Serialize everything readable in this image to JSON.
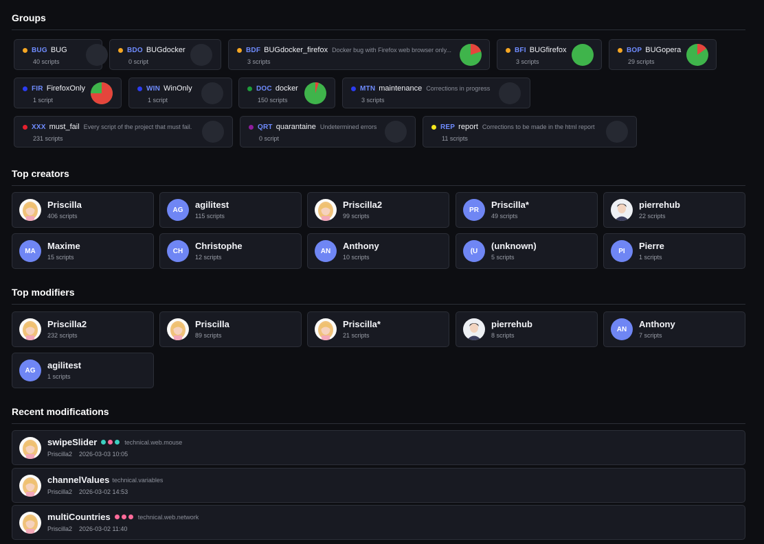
{
  "sections": {
    "groups": "Groups",
    "top_creators": "Top creators",
    "top_modifiers": "Top modifiers",
    "recent": "Recent modifications"
  },
  "colors": {
    "pass": "#3fb44b",
    "fail": "#e5453c",
    "empty": "#262932",
    "avatar_bg": "#6f86f4",
    "dot_teal": "#3ccfc0",
    "dot_pink": "#ff6b9a"
  },
  "groups": [
    {
      "code": "BUG",
      "name": "BUG",
      "desc": "",
      "count": "40 scripts",
      "dot": "#f5a623",
      "fail_ratio": null
    },
    {
      "code": "BDO",
      "name": "BUGdocker",
      "desc": "",
      "count": "0 script",
      "dot": "#f5a623",
      "fail_ratio": null
    },
    {
      "code": "BDF",
      "name": "BUGdocker_firefox",
      "desc": "Docker bug with Firefox web browser only...",
      "count": "3 scripts",
      "dot": "#f5a623",
      "fail_ratio": 0.2
    },
    {
      "code": "BFI",
      "name": "BUGfirefox",
      "desc": "",
      "count": "3 scripts",
      "dot": "#f5a623",
      "fail_ratio": 0
    },
    {
      "code": "BOP",
      "name": "BUGopera",
      "desc": "",
      "count": "29 scripts",
      "dot": "#f5a623",
      "fail_ratio": 0.15
    },
    {
      "code": "FIR",
      "name": "FirefoxOnly",
      "desc": "",
      "count": "1 script",
      "dot": "#2b3cf0",
      "fail_ratio": 0.75
    },
    {
      "code": "WIN",
      "name": "WinOnly",
      "desc": "",
      "count": "1 script",
      "dot": "#2b3cf0",
      "fail_ratio": null
    },
    {
      "code": "DOC",
      "name": "docker",
      "desc": "",
      "count": "150 scripts",
      "dot": "#1e9b3a",
      "fail_ratio": 0.05
    },
    {
      "code": "MTN",
      "name": "maintenance",
      "desc": "Corrections in progress",
      "count": "3 scripts",
      "dot": "#2b3cf0",
      "fail_ratio": null
    },
    {
      "code": "XXX",
      "name": "must_fail",
      "desc": "Every script of the project that must fail.",
      "count": "231 scripts",
      "dot": "#e5202e",
      "fail_ratio": null
    },
    {
      "code": "QRT",
      "name": "quarantaine",
      "desc": "Undetermined errors",
      "count": "0 script",
      "dot": "#8e1d9c",
      "fail_ratio": null
    },
    {
      "code": "REP",
      "name": "report",
      "desc": "Corrections to be made in the html report",
      "count": "11 scripts",
      "dot": "#f5e81d",
      "fail_ratio": null
    }
  ],
  "creators": [
    {
      "name": "Priscilla",
      "count": "406 scripts",
      "avatar": "photo-blonde",
      "initials": ""
    },
    {
      "name": "agilitest",
      "count": "115 scripts",
      "avatar": "initials",
      "initials": "AG"
    },
    {
      "name": "Priscilla2",
      "count": "99 scripts",
      "avatar": "photo-blonde",
      "initials": ""
    },
    {
      "name": "Priscilla*",
      "count": "49 scripts",
      "avatar": "initials",
      "initials": "PR"
    },
    {
      "name": "pierrehub",
      "count": "22 scripts",
      "avatar": "photo-man",
      "initials": ""
    },
    {
      "name": "Maxime",
      "count": "15 scripts",
      "avatar": "initials",
      "initials": "MA"
    },
    {
      "name": "Christophe",
      "count": "12 scripts",
      "avatar": "initials",
      "initials": "CH"
    },
    {
      "name": "Anthony",
      "count": "10 scripts",
      "avatar": "initials",
      "initials": "AN"
    },
    {
      "name": "(unknown)",
      "count": "5 scripts",
      "avatar": "initials",
      "initials": "(U"
    },
    {
      "name": "Pierre",
      "count": "1 scripts",
      "avatar": "initials",
      "initials": "PI"
    }
  ],
  "modifiers": [
    {
      "name": "Priscilla2",
      "count": "232 scripts",
      "avatar": "photo-blonde",
      "initials": ""
    },
    {
      "name": "Priscilla",
      "count": "89 scripts",
      "avatar": "photo-blonde",
      "initials": ""
    },
    {
      "name": "Priscilla*",
      "count": "21 scripts",
      "avatar": "photo-blonde",
      "initials": ""
    },
    {
      "name": "pierrehub",
      "count": "8 scripts",
      "avatar": "photo-man",
      "initials": ""
    },
    {
      "name": "Anthony",
      "count": "7 scripts",
      "avatar": "initials",
      "initials": "AN"
    },
    {
      "name": "agilitest",
      "count": "1 scripts",
      "avatar": "initials",
      "initials": "AG"
    }
  ],
  "recent": [
    {
      "name": "swipeSlider",
      "dots": [
        "teal",
        "pink",
        "teal"
      ],
      "path": "technical.web.mouse",
      "user": "Priscilla2",
      "date": "2026-03-03 10:05"
    },
    {
      "name": "channelValues",
      "dots": [],
      "path": "technical.variables",
      "user": "Priscilla2",
      "date": "2026-03-02 14:53"
    },
    {
      "name": "multiCountries",
      "dots": [
        "pink",
        "pink",
        "pink"
      ],
      "path": "technical.web.network",
      "user": "Priscilla2",
      "date": "2026-03-02 11:40"
    }
  ]
}
